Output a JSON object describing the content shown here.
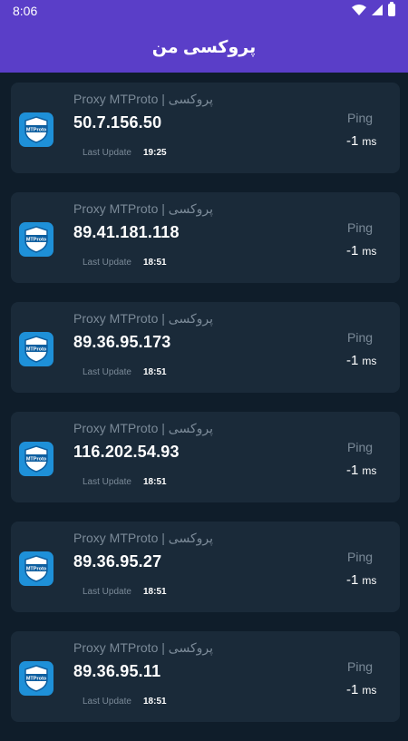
{
  "status_bar": {
    "time": "8:06"
  },
  "app_bar": {
    "title": "پروکسی من"
  },
  "proxies": [
    {
      "label": "Proxy MTProto | پروکسی",
      "ip": "50.7.156.50",
      "last_update_label": "Last Update",
      "last_update_time": "19:25",
      "ping_label": "Ping",
      "ping_value": "-1",
      "ping_unit": "ms"
    },
    {
      "label": "Proxy MTProto | پروکسی",
      "ip": "89.41.181.118",
      "last_update_label": "Last Update",
      "last_update_time": "18:51",
      "ping_label": "Ping",
      "ping_value": "-1",
      "ping_unit": "ms"
    },
    {
      "label": "Proxy MTProto | پروکسی",
      "ip": "89.36.95.173",
      "last_update_label": "Last Update",
      "last_update_time": "18:51",
      "ping_label": "Ping",
      "ping_value": "-1",
      "ping_unit": "ms"
    },
    {
      "label": "Proxy MTProto | پروکسی",
      "ip": "116.202.54.93",
      "last_update_label": "Last Update",
      "last_update_time": "18:51",
      "ping_label": "Ping",
      "ping_value": "-1",
      "ping_unit": "ms"
    },
    {
      "label": "Proxy MTProto | پروکسی",
      "ip": "89.36.95.27",
      "last_update_label": "Last Update",
      "last_update_time": "18:51",
      "ping_label": "Ping",
      "ping_value": "-1",
      "ping_unit": "ms"
    },
    {
      "label": "Proxy MTProto | پروکسی",
      "ip": "89.36.95.11",
      "last_update_label": "Last Update",
      "last_update_time": "18:51",
      "ping_label": "Ping",
      "ping_value": "-1",
      "ping_unit": "ms"
    }
  ],
  "logo_text": "MTProto",
  "colors": {
    "app_bar": "#5a3ec8",
    "background": "#0f1d2a",
    "card": "#1a2a39",
    "logo": "#1e90d8"
  }
}
